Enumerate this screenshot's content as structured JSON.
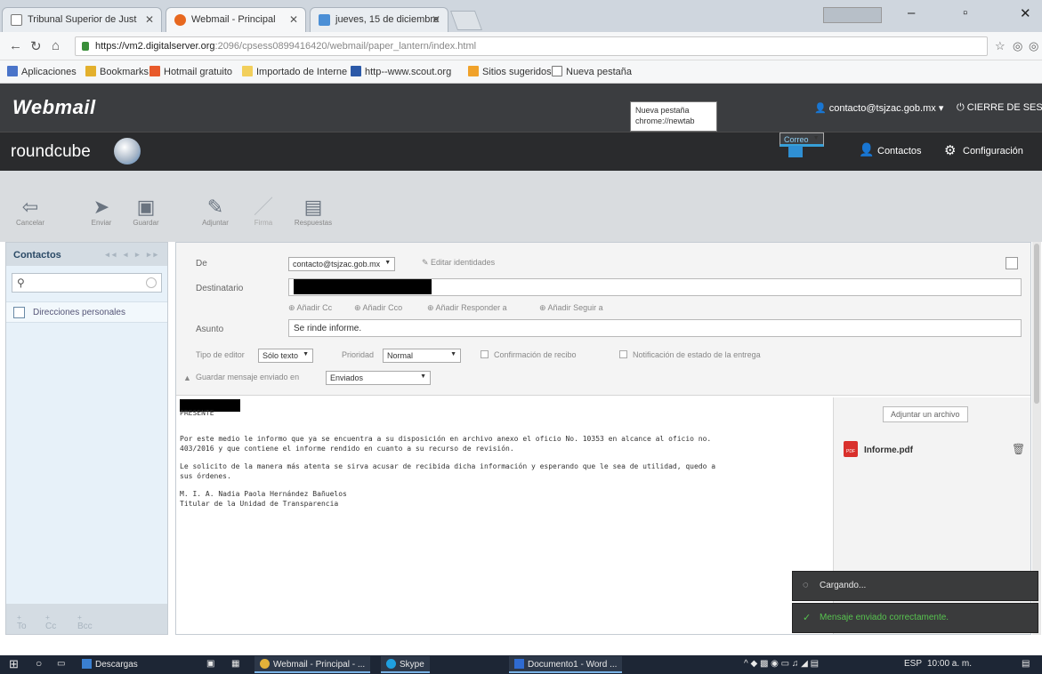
{
  "browser": {
    "tabs": [
      {
        "label": "Tribunal Superior de Just",
        "icon": "page-icon"
      },
      {
        "label": "Webmail - Principal",
        "icon": "cpanel-icon"
      },
      {
        "label": "jueves, 15 de diciembre",
        "icon": "weather-icon"
      }
    ],
    "url_host": "https://vm2.digitalserver.org",
    "url_rest": ":2096/cpsess0899416420/webmail/paper_lantern/index.html",
    "bookmarks": [
      "Aplicaciones",
      "Bookmarks",
      "Hotmail gratuito",
      "Importado de Interne",
      "http--www.scout.org",
      "Sitios sugeridos",
      "Nueva pestaña"
    ]
  },
  "webmail": {
    "logo": "Webmail",
    "tooltip": {
      "line1": "Nueva pestaña",
      "line2": "chrome://newtab"
    },
    "user": "contacto@tsjzac.gob.mx",
    "logout": "CIERRE DE SESIÓN"
  },
  "roundcube": {
    "logo": "roundcube",
    "nav": [
      {
        "label": "Correo",
        "icon": "mail-icon",
        "selected": true
      },
      {
        "label": "Contactos",
        "icon": "person-icon",
        "selected": false
      },
      {
        "label": "Configuración",
        "icon": "gear-icon",
        "selected": false
      }
    ]
  },
  "toolbar": {
    "cancel": "Cancelar",
    "send": "Enviar",
    "save": "Guardar",
    "attach": "Adjuntar",
    "sign": "Firma",
    "responses": "Respuestas"
  },
  "contacts": {
    "title": "Contactos",
    "address_book": "Direcciones personales",
    "footer": [
      "To",
      "Cc",
      "Bcc"
    ]
  },
  "compose": {
    "from_label": "De",
    "from_value": "contacto@tsjzac.gob.mx",
    "edit_identities": "Editar identidades",
    "to_label": "Destinatario",
    "add_links": [
      "Añadir Cc",
      "Añadir Cco",
      "Añadir Responder a",
      "Añadir Seguir a"
    ],
    "subject_label": "Asunto",
    "subject_value": "Se rinde informe.",
    "editor_label": "Tipo de editor",
    "editor_value": "Sólo texto",
    "priority_label": "Prioridad",
    "priority_value": "Normal",
    "receipt_label": "Confirmación de recibo",
    "dsn_label": "Notificación de estado de la entrega",
    "save_label": "Guardar mensaje enviado en",
    "save_value": "Enviados",
    "body": {
      "greeting": "PRESENTE",
      "p1": "Por este medio le informo que ya se encuentra a su disposición en archivo anexo el oficio No. 10353 en alcance al oficio no.\n403/2016 y que contiene el informe rendido en cuanto a su recurso de revisión.",
      "p2": "Le solicito de la manera más atenta se sirva acusar de recibida dicha información y esperando que le sea de utilidad, quedo a\nsus órdenes.",
      "sig1": "M. I. A. Nadia Paola Hernández Bañuelos",
      "sig2": "Titular de la Unidad de Transparencia"
    },
    "attach_button": "Adjuntar un archivo",
    "attachment": "Informe.pdf"
  },
  "notifications": {
    "loading": "Cargando...",
    "sent": "Mensaje enviado correctamente."
  },
  "taskbar": {
    "downloads": "Descargas",
    "webmail": "Webmail - Principal - ...",
    "skype": "Skype",
    "word": "Documento1 - Word ...",
    "lang": "ESP",
    "time": "10:00 a. m."
  },
  "colors": {
    "accent": "#37a0d8",
    "header": "#3b3d40",
    "bar": "#2a2b2d",
    "success": "#57c34f"
  }
}
